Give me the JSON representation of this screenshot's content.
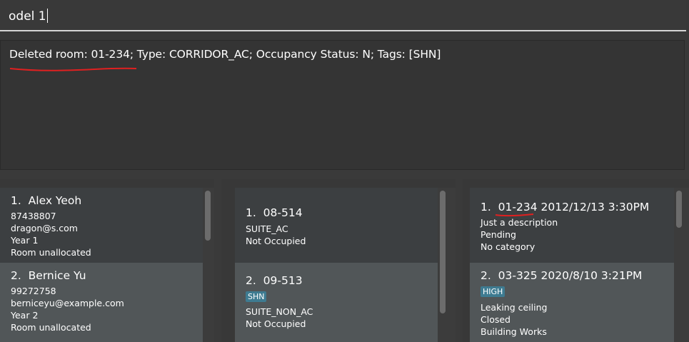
{
  "command": {
    "value": "odel 1"
  },
  "result": {
    "message": "Deleted room: 01-234; Type: CORRIDOR_AC; Occupancy Status: N; Tags: [SHN]"
  },
  "residents": [
    {
      "index": "1.",
      "name": "Alex Yeoh",
      "phone": "87438807",
      "email": "dragon@s.com",
      "year": "Year 1",
      "room": "Room unallocated"
    },
    {
      "index": "2.",
      "name": "Bernice Yu",
      "phone": "99272758",
      "email": "berniceyu@example.com",
      "year": "Year 2",
      "room": "Room unallocated"
    }
  ],
  "rooms": [
    {
      "index": "1.",
      "number": "08-514",
      "tag": "",
      "type": "SUITE_AC",
      "status": "Not Occupied"
    },
    {
      "index": "2.",
      "number": "09-513",
      "tag": "SHN",
      "type": "SUITE_NON_AC",
      "status": "Not Occupied"
    }
  ],
  "issues": [
    {
      "index": "1.",
      "room": "01-234",
      "datetime": "2012/12/13 3:30PM",
      "tag": "",
      "description": "Just a description",
      "status": "Pending",
      "category": "No category"
    },
    {
      "index": "2.",
      "room": "03-325",
      "datetime": "2020/8/10 3:21PM",
      "tag": "HIGH",
      "description": "Leaking ceiling",
      "status": "Closed",
      "category": "Building Works"
    }
  ],
  "colors": {
    "background": "#383838",
    "card_odd": "#3c3f41",
    "card_even": "#515658",
    "tag": "#3e7b91",
    "annotation": "#e02020"
  }
}
